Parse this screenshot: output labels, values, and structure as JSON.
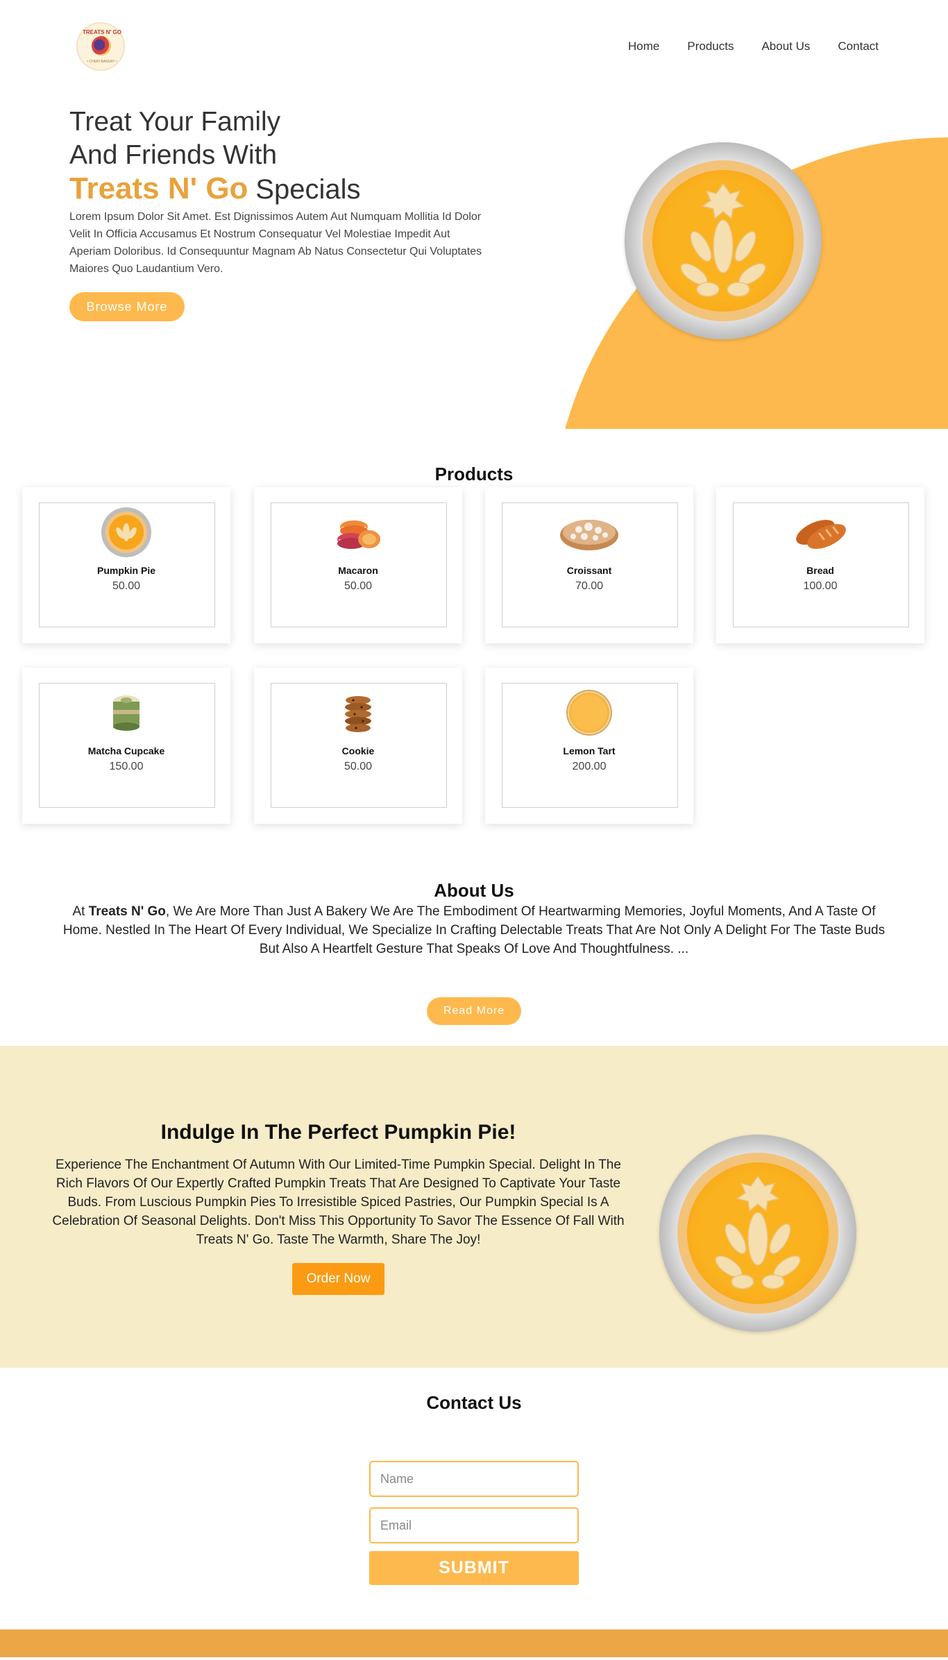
{
  "nav": {
    "logo_text": "TREATS N' GO",
    "logo_sub": "• CHERI BAKERY •",
    "links": [
      "Home",
      "Products",
      "About Us",
      "Contact"
    ]
  },
  "hero": {
    "title_line1": "Treat Your Family",
    "title_line2": "And Friends With",
    "brand": "Treats N' Go",
    "title_end": "Specials",
    "description": "Lorem Ipsum Dolor Sit Amet. Est Dignissimos Autem Aut Numquam Mollitia Id Dolor Velit In Officia Accusamus Et Nostrum Consequatur Vel Molestiae Impedit Aut Aperiam Doloribus. Id Consequuntur Magnam Ab Natus Consectetur Qui Voluptates Maiores Quo Laudantium Vero.",
    "button": "Browse More"
  },
  "products": {
    "title": "Products",
    "items": [
      {
        "name": "Pumpkin Pie",
        "price": "50.00",
        "icon": "pumpkin-pie-icon"
      },
      {
        "name": "Macaron",
        "price": "50.00",
        "icon": "macaron-icon"
      },
      {
        "name": "Croissant",
        "price": "70.00",
        "icon": "croissant-icon"
      },
      {
        "name": "Bread",
        "price": "100.00",
        "icon": "bread-icon"
      },
      {
        "name": "Matcha Cupcake",
        "price": "150.00",
        "icon": "cupcake-icon"
      },
      {
        "name": "Cookie",
        "price": "50.00",
        "icon": "cookie-icon"
      },
      {
        "name": "Lemon Tart",
        "price": "200.00",
        "icon": "lemon-tart-icon"
      }
    ]
  },
  "about": {
    "title": "About Us",
    "prefix": "At ",
    "brand": "Treats N' Go",
    "text": ", We Are More Than Just A Bakery We Are The Embodiment Of Heartwarming Memories, Joyful Moments, And A Taste Of Home. Nestled In The Heart Of Every Individual, We Specialize In Crafting Delectable Treats That Are Not Only A Delight For The Taste Buds But Also A Heartfelt Gesture That Speaks Of Love And Thoughtfulness. ...",
    "button": "Read More"
  },
  "special": {
    "title": "Indulge In The Perfect Pumpkin Pie!",
    "text": "Experience The Enchantment Of Autumn With Our Limited-Time Pumpkin Special. Delight In The Rich Flavors Of Our Expertly Crafted Pumpkin Treats That Are Designed To Captivate Your Taste Buds. From Luscious Pumpkin Pies To Irresistible Spiced Pastries, Our Pumpkin Special Is A Celebration Of Seasonal Delights. Don't Miss This Opportunity To Savor The Essence Of Fall With Treats N' Go. Taste The Warmth, Share The Joy!",
    "button": "Order Now"
  },
  "contact": {
    "title": "Contact Us",
    "name_placeholder": "Name",
    "email_placeholder": "Email",
    "button": "SUBMIT"
  },
  "colors": {
    "accent": "#fdb94d",
    "brand_text": "#e9a23b",
    "order_button": "#fb9b13",
    "special_bg": "#f6ecc8",
    "footer": "#eca645"
  }
}
